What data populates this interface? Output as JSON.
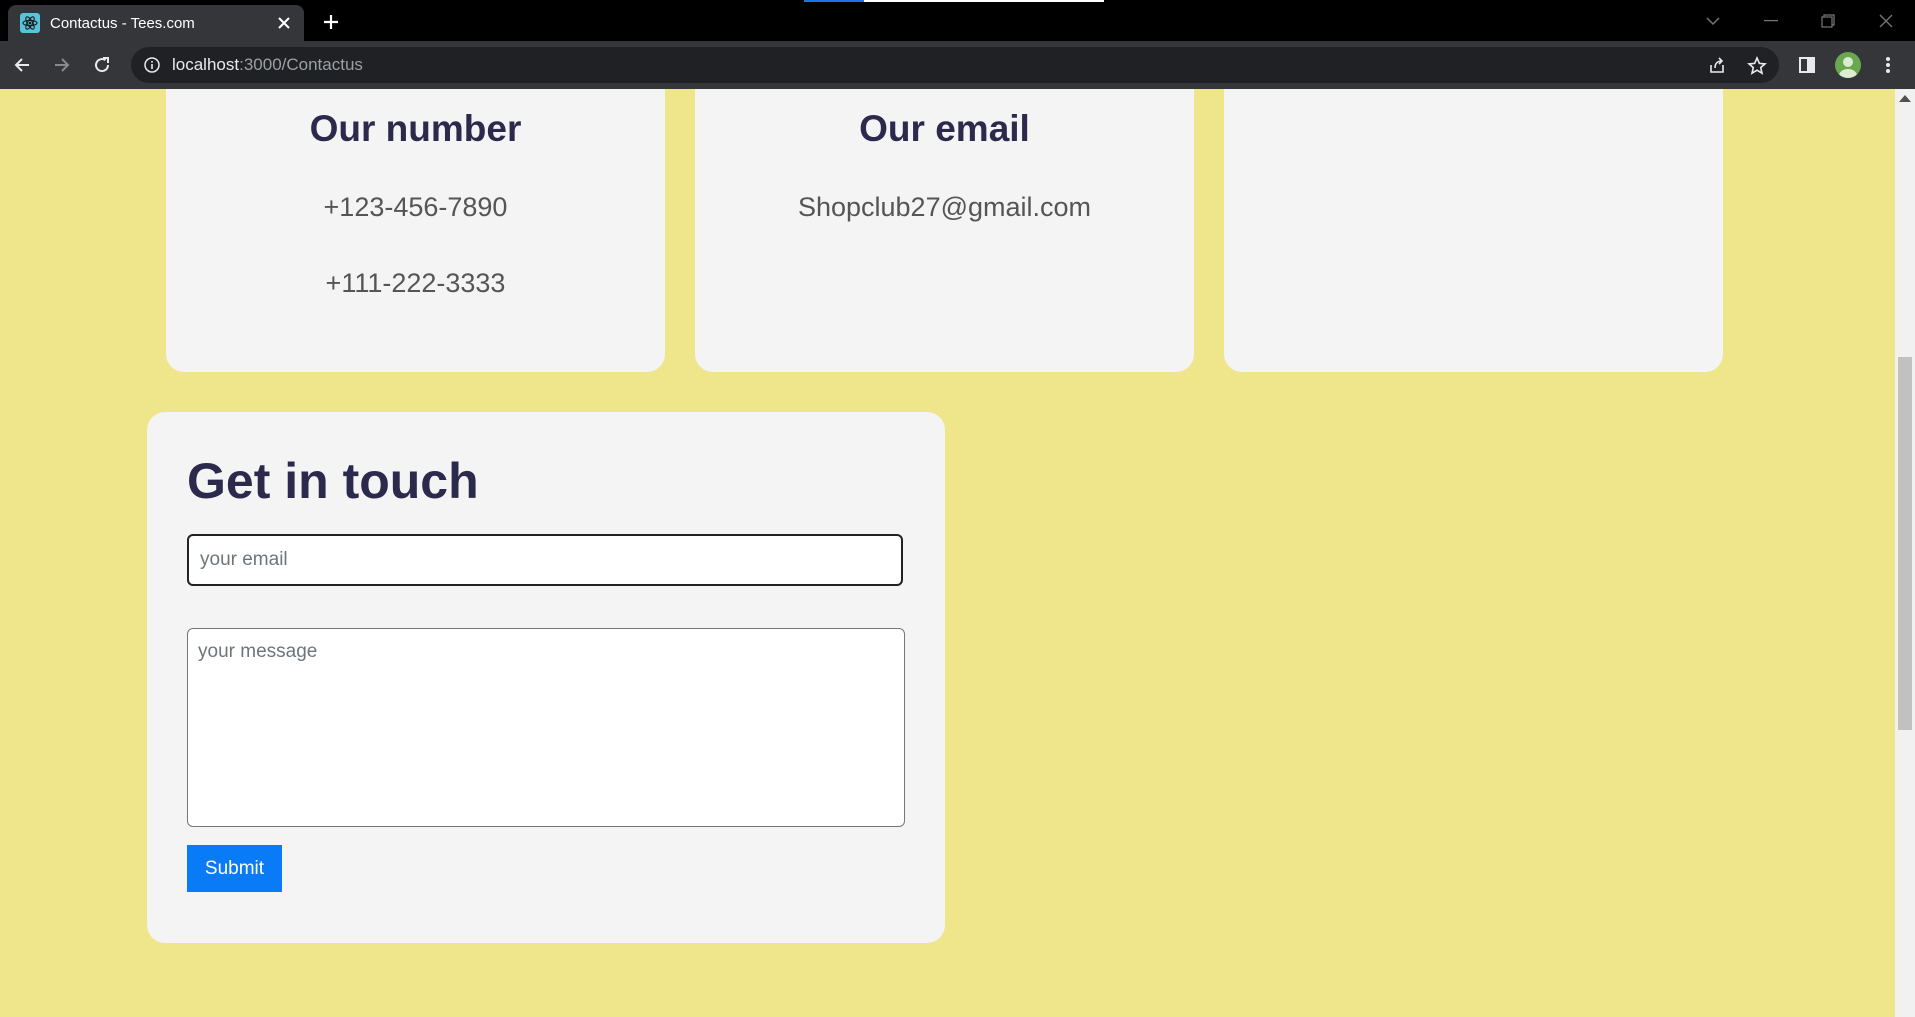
{
  "browser": {
    "tab_title": "Contactus - Tees.com",
    "url_host": "localhost",
    "url_rest": ":3000/Contactus"
  },
  "cards": [
    {
      "heading": "Our number",
      "lines": [
        "+123-456-7890",
        "+111-222-3333"
      ]
    },
    {
      "heading": "Our email",
      "lines": [
        "Shopclub27@gmail.com"
      ]
    },
    {
      "heading": "",
      "lines": []
    }
  ],
  "form": {
    "title": "Get in touch",
    "email_placeholder": "your email",
    "message_placeholder": "your message",
    "submit_label": "Submit"
  },
  "colors": {
    "page_background": "#efe68c",
    "card_background": "#f4f4f4",
    "heading_color": "#2b2a4c",
    "submit_button": "#0a7bf6"
  }
}
